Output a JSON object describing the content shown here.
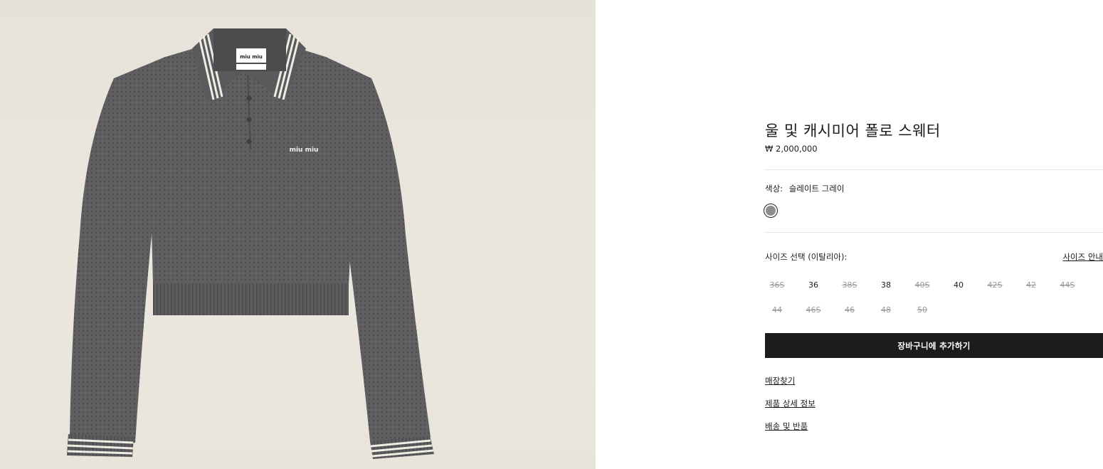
{
  "product": {
    "title": "울 및 캐시미어 폴로 스웨터",
    "price": "₩ 2,000,000",
    "image_alt": "울 및 캐시미어 폴로 스웨터",
    "logo_text": "miu miu"
  },
  "color": {
    "label": "색상:",
    "value": "슬레이트 그레이",
    "swatch_color": "#8e8e8e"
  },
  "size": {
    "label": "사이즈 선택 (이탈리아):",
    "guide_label": "사이즈 안내",
    "options": [
      {
        "label": "36S",
        "available": false
      },
      {
        "label": "36",
        "available": true
      },
      {
        "label": "38S",
        "available": false
      },
      {
        "label": "38",
        "available": true
      },
      {
        "label": "40S",
        "available": false
      },
      {
        "label": "40",
        "available": true
      },
      {
        "label": "42S",
        "available": false
      },
      {
        "label": "42",
        "available": false
      },
      {
        "label": "44S",
        "available": false
      },
      {
        "label": "44",
        "available": false
      },
      {
        "label": "46S",
        "available": false
      },
      {
        "label": "46",
        "available": false
      },
      {
        "label": "48",
        "available": false
      },
      {
        "label": "50",
        "available": false
      }
    ]
  },
  "actions": {
    "add_to_cart": "장바구니에 추가하기"
  },
  "links": {
    "store_finder": "매장찾기",
    "product_details": "제품 상세 정보",
    "shipping_returns": "배송 및 반품"
  },
  "theme": {
    "accent": "#1b1c1e",
    "sweater": "#5f5f61",
    "stripe_light": "#efece4"
  }
}
